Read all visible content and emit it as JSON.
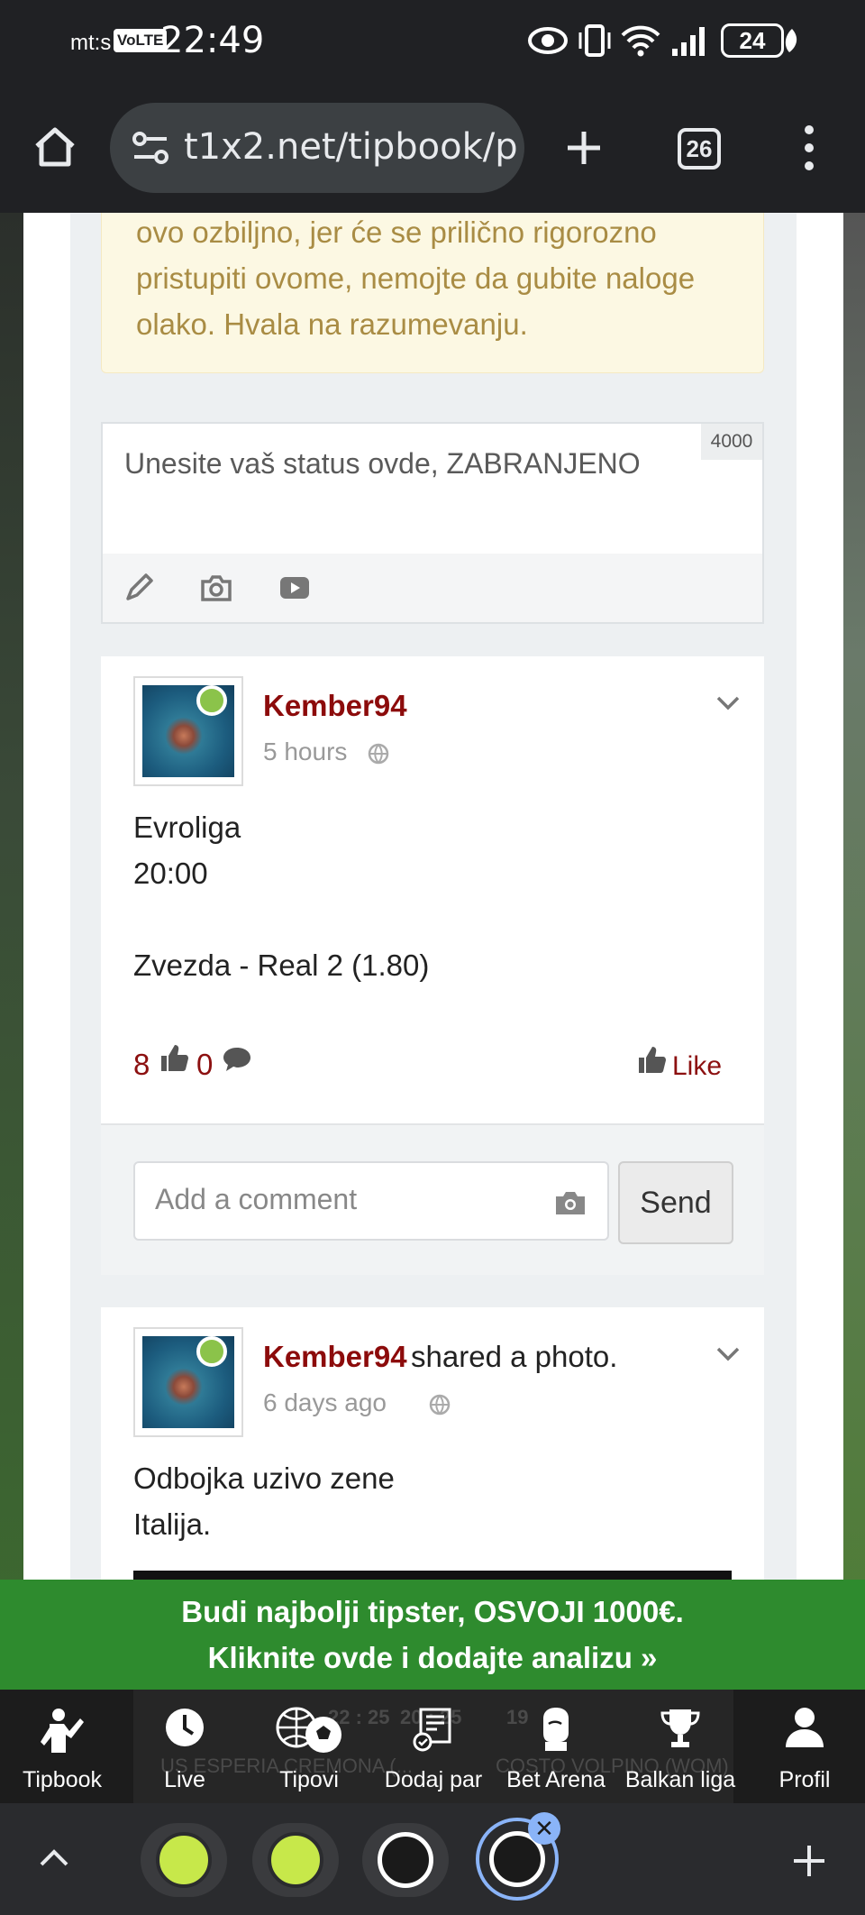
{
  "status_bar": {
    "carrier": "mt:s",
    "volte": "VoLTE",
    "time": "22:49",
    "battery": "24"
  },
  "browser": {
    "url": "t1x2.net/tipbook/p",
    "tab_count": "26"
  },
  "warning": {
    "text": "ovo ozbiljno, jer će se prilično rigorozno pristupiti ovome, nemojte da gubite naloge olako. Hvala na razumevanju."
  },
  "status_composer": {
    "placeholder": "Unesite vaš status ovde, ZABRANJENO",
    "char_limit": "4000"
  },
  "posts": [
    {
      "username": "Kember94",
      "action": "",
      "time": "5 hours",
      "lines": [
        "Evroliga",
        "20:00",
        "",
        "Zvezda - Real 2 (1.80)"
      ],
      "likes": "8",
      "comments": "0",
      "like_label": "Like"
    },
    {
      "username": "Kember94",
      "action": "shared a photo.",
      "time": "6 days ago",
      "lines": [
        "Odbojka uzivo zene",
        "Italija."
      ]
    }
  ],
  "comment_box": {
    "placeholder": "Add a comment",
    "send_label": "Send"
  },
  "promo": {
    "line1": "Budi najbolji tipster, OSVOJI 1000€.",
    "line2": "Kliknite ovde i dodajte analizu »"
  },
  "background_strip": {
    "score1": "22 : 25",
    "score2": "20 : 25",
    "score3": "19",
    "team1": "US ESPERIA CREMONA (...",
    "team2": "COSTO VOLPINO (WOM)"
  },
  "bottom_nav": [
    {
      "label": "Tipbook",
      "icon": "tipster-icon"
    },
    {
      "label": "Live",
      "icon": "clock-icon"
    },
    {
      "label": "Tipovi",
      "icon": "balls-icon"
    },
    {
      "label": "Dodaj par",
      "icon": "ticket-icon"
    },
    {
      "label": "Bet Arena",
      "icon": "glove-icon"
    },
    {
      "label": "Balkan liga",
      "icon": "trophy-icon"
    },
    {
      "label": "Profil",
      "icon": "user-icon"
    }
  ],
  "colors": {
    "accent": "#8c0b0b",
    "promo": "#2e8b2e",
    "warning_bg": "#fcf8e3",
    "warning_text": "#a98c44"
  }
}
